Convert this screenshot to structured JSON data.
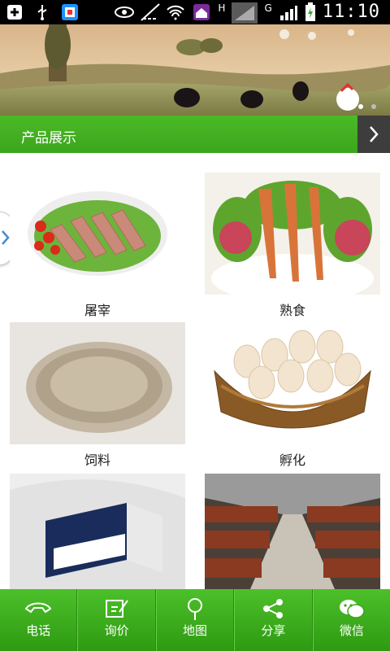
{
  "status_bar": {
    "clock": "11:10",
    "network_h": "H",
    "network_g": "G",
    "icons": [
      "add-icon",
      "usb-icon",
      "app-icon",
      "eye-icon",
      "no-signal-icon",
      "wifi-icon",
      "home-app-icon",
      "signal-bars-icon",
      "battery-charging-icon"
    ]
  },
  "banner": {
    "name": "farm-chickens-banner",
    "page_dots": 2,
    "active_dot": 0
  },
  "section": {
    "title": "产品展示"
  },
  "products": [
    {
      "label": "屠宰",
      "image": "meat-on-lettuce"
    },
    {
      "label": "熟食",
      "image": "cooked-chicken-feet"
    },
    {
      "label": "饲料",
      "image": "feed-pellets"
    },
    {
      "label": "孵化",
      "image": "eggs-in-basket"
    },
    {
      "label": "",
      "image": "product-box"
    },
    {
      "label": "",
      "image": "chicken-cages"
    }
  ],
  "tabbar": {
    "items": [
      {
        "label": "电话",
        "icon": "phone-icon"
      },
      {
        "label": "询价",
        "icon": "edit-icon"
      },
      {
        "label": "地图",
        "icon": "map-pin-icon"
      },
      {
        "label": "分享",
        "icon": "share-icon"
      },
      {
        "label": "微信",
        "icon": "wechat-icon"
      }
    ]
  },
  "colors": {
    "accent_green": "#3fa91f",
    "status_bar": "#000000",
    "arrow_box": "#3d3d3d"
  }
}
